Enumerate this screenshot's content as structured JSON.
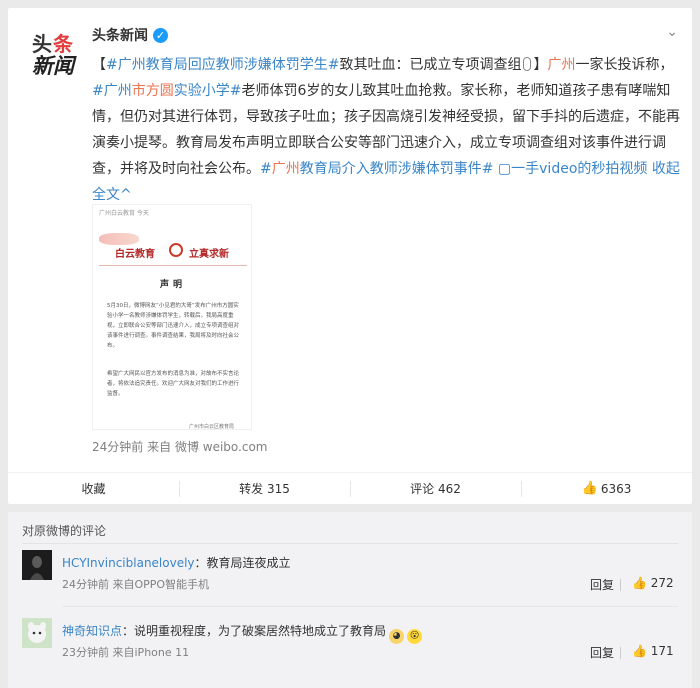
{
  "post": {
    "avatar_text": {
      "line1_a": "头",
      "line1_b": "条",
      "line2": "新闻"
    },
    "author": "头条新闻",
    "segments": [
      {
        "t": "【",
        "c": "plain"
      },
      {
        "t": "#广州",
        "c": "b"
      },
      {
        "t": "教育局回应教师涉嫌体罚学生#",
        "c": "b"
      },
      {
        "t": "致其吐血：已成立专项调查组",
        "c": "plain"
      },
      {
        "t": "mic",
        "c": "mic"
      },
      {
        "t": "】",
        "c": "plain"
      },
      {
        "t": "广州",
        "c": "a"
      },
      {
        "t": "一家长投诉称，",
        "c": "plain"
      },
      {
        "t": "#广州",
        "c": "b"
      },
      {
        "t": "市方圆",
        "c": "a"
      },
      {
        "t": "实验小学#",
        "c": "b"
      },
      {
        "t": "老师体罚6岁的女儿致其吐血抢救。家长称，老师知道孩子患有哮喘知情，但仍对其进行体罚，导致孩子吐血；孩子因高烧引发神经受损，留下手抖的后遗症，不能再演奏小提琴。教育局发布声明立即联合公安等部门迅速介入，成立专项调查组对该事件进行调查，并将及时向社会公布。",
        "c": "plain"
      },
      {
        "t": "#",
        "c": "b"
      },
      {
        "t": "广州",
        "c": "a"
      },
      {
        "t": "教育局介入教师涉嫌体罚事件#",
        "c": "b"
      },
      {
        "t": " ▢一手video的秒拍视频",
        "c": "b"
      },
      {
        "t": " 收起全文^",
        "c": "b"
      }
    ],
    "attachment": {
      "source": "广州白云教育  今天",
      "slogan_left": "白云教育",
      "slogan_right": "立真求新",
      "heading": "声明",
      "para1": "5月30日，微博网友“小见君的大哥”发布广州市方圆实验小学一名教师涉嫌体罚学生，转载后，我局高度重视，立即联合公安等部门迅速介入，成立专项调查组对该事件进行调查。事件调查结果，我局将及时向社会公布。",
      "para2": "希望广大网民以官方发布的消息为准，对故布不实言论者，将依法追究责任。欢迎广大网友对我们的工作进行监督。",
      "signature": "广州市白云区教育局"
    },
    "time": "24分钟前",
    "via_label": "来自",
    "via": "微博 weibo.com"
  },
  "actions": {
    "favorite": "收藏",
    "repost": "转发 315",
    "comment": "评论 462",
    "like": "6363"
  },
  "comments": {
    "title": "对原微博的评论",
    "items": [
      {
        "user": "HCYInvinciblanelovely",
        "text": "：教育局连夜成立",
        "time": "24分钟前",
        "source": "来自OPPO智能手机",
        "reply": "回复",
        "likes": "272"
      },
      {
        "user": "神奇知识点",
        "text": "：说明重视程度，为了破案居然特地成立了教育局",
        "time": "23分钟前",
        "source": "来自iPhone 11",
        "reply": "回复",
        "likes": "171"
      }
    ]
  },
  "colors": {
    "link": "#3a85c7",
    "hashtag_accent": "#eb7350",
    "verified": "#1a9cff"
  }
}
